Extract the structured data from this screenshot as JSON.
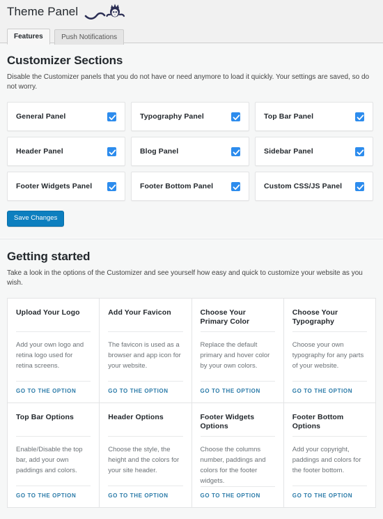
{
  "header": {
    "title": "Theme Panel",
    "logo_icon": "mascot-cat-icon"
  },
  "tabs": [
    {
      "label": "Features",
      "active": true
    },
    {
      "label": "Push Notifications",
      "active": false
    }
  ],
  "customizer_sections": {
    "heading": "Customizer Sections",
    "description": "Disable the Customizer panels that you do not have or need anymore to load it quickly. Your settings are saved, so do not worry.",
    "panels": [
      {
        "label": "General Panel",
        "checked": true
      },
      {
        "label": "Typography Panel",
        "checked": true
      },
      {
        "label": "Top Bar Panel",
        "checked": true
      },
      {
        "label": "Header Panel",
        "checked": true
      },
      {
        "label": "Blog Panel",
        "checked": true
      },
      {
        "label": "Sidebar Panel",
        "checked": true
      },
      {
        "label": "Footer Widgets Panel",
        "checked": true
      },
      {
        "label": "Footer Bottom Panel",
        "checked": true
      },
      {
        "label": "Custom CSS/JS Panel",
        "checked": true
      }
    ],
    "save_label": "Save Changes"
  },
  "getting_started": {
    "heading": "Getting started",
    "description": "Take a look in the options of the Customizer and see yourself how easy and quick to customize your website as you wish.",
    "link_label": "GO TO THE OPTION",
    "cards": [
      {
        "title": "Upload Your Logo",
        "body": "Add your own logo and retina logo used for retina screens.",
        "link": "GO TO THE OPTION"
      },
      {
        "title": "Add Your Favicon",
        "body": "The favicon is used as a browser and app icon for your website.",
        "link": "GO TO THE OPTION"
      },
      {
        "title": "Choose Your Primary Color",
        "body": "Replace the default primary and hover color by your own colors.",
        "link": "GO TO THE OPTION"
      },
      {
        "title": "Choose Your Typography",
        "body": "Choose your own typography for any parts of your website.",
        "link": "GO TO THE OPTION"
      },
      {
        "title": "Top Bar Options",
        "body": "Enable/Disable the top bar, add your own paddings and colors.",
        "link": "GO TO THE OPTION"
      },
      {
        "title": "Header Options",
        "body": "Choose the style, the height and the colors for your site header.",
        "link": "GO TO THE OPTION"
      },
      {
        "title": "Footer Widgets Options",
        "body": "Choose the columns number, paddings and colors for the footer widgets.",
        "link": "GO TO THE OPTION"
      },
      {
        "title": "Footer Bottom Options",
        "body": "Add your copyright, paddings and colors for the footer bottom.",
        "link": "GO TO THE OPTION"
      }
    ]
  },
  "colors": {
    "accent_blue": "#0d7fbf",
    "checkbox_blue": "#2d8ced",
    "link_blue": "#2a7aa8",
    "page_bg": "#f1f1f1",
    "logo_navy": "#2b2e54"
  }
}
